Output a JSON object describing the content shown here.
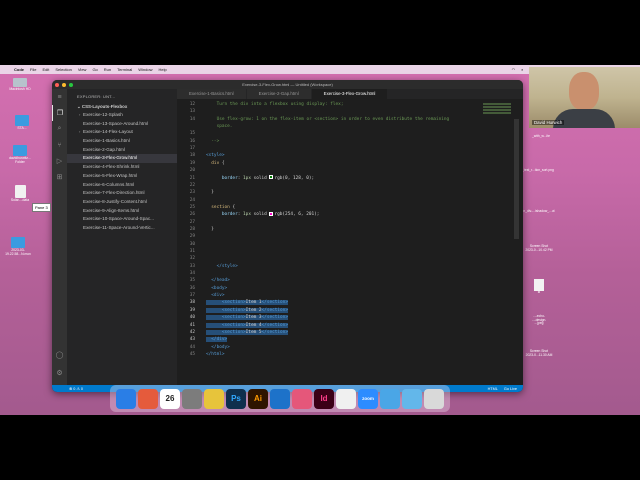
{
  "menubar": {
    "app": "Code",
    "items": [
      "File",
      "Edit",
      "Selection",
      "View",
      "Go",
      "Run",
      "Terminal",
      "Window",
      "Help"
    ],
    "clock": "Sun Mar 26"
  },
  "desktop_left_icons": [
    {
      "label": "Macintosh HD",
      "kind": "drive"
    },
    {
      "label": "STA...",
      "kind": "folder"
    },
    {
      "label": "davidhurwitz...\nFolder",
      "kind": "folder"
    },
    {
      "label": "Solar...-data",
      "kind": "doc"
    },
    {
      "label": "2023-03-\n19.22.58...N.mov",
      "kind": "folder"
    }
  ],
  "tooltip": "Pane 3",
  "vscode": {
    "title": "Exercise-3-Flex-Grow.html — Untitled (Workspace)",
    "explorer_header": "EXPLORER: UNT...",
    "root_folder": "CSS-Layouts-Flexbox",
    "files": [
      {
        "name": "Exercise-12-Splash",
        "folder": true,
        "selected": false
      },
      {
        "name": "Exercise-13-Space-Around.html",
        "folder": false,
        "selected": false
      },
      {
        "name": "Exercise-14-Flex-Layout",
        "folder": true,
        "selected": false
      },
      {
        "name": "Exercise-1-Basics.html",
        "folder": false,
        "selected": false
      },
      {
        "name": "Exercise-2-Gap.html",
        "folder": false,
        "selected": false
      },
      {
        "name": "Exercise-3-Flex-Grow.html",
        "folder": false,
        "selected": true
      },
      {
        "name": "Exercise-4-Flex-Shrink.html",
        "folder": false,
        "selected": false
      },
      {
        "name": "Exercise-5-Flex-Wrap.html",
        "folder": false,
        "selected": false
      },
      {
        "name": "Exercise-6-Columns.html",
        "folder": false,
        "selected": false
      },
      {
        "name": "Exercise-7-Flex-Direction.html",
        "folder": false,
        "selected": false
      },
      {
        "name": "Exercise-8-Justify-Content.html",
        "folder": false,
        "selected": false
      },
      {
        "name": "Exercise-9-Align-Items.html",
        "folder": false,
        "selected": false
      },
      {
        "name": "Exercise-10-Space-Around-Spac...",
        "folder": false,
        "selected": false
      },
      {
        "name": "Exercise-11-Space-Around-Vertic...",
        "folder": false,
        "selected": false
      }
    ],
    "tabs": [
      {
        "label": "Exercise-1-Basics.html",
        "active": false
      },
      {
        "label": "Exercise-2-Gap.html",
        "active": false
      },
      {
        "label": "Exercise-3-Flex-Grow.html",
        "active": true
      }
    ],
    "code_lines": [
      {
        "n": "12",
        "parts": [
          {
            "c": "t-cm",
            "t": "    Turn the div into a flexbox using display: flex;"
          }
        ]
      },
      {
        "n": "13",
        "parts": []
      },
      {
        "n": "14",
        "parts": [
          {
            "c": "t-cm",
            "t": "    Use flex-grow: 1 on the flex-item or <section> in order to even distribute the remaining"
          }
        ]
      },
      {
        "n": "",
        "parts": [
          {
            "c": "t-cm",
            "t": "    space."
          }
        ]
      },
      {
        "n": "15",
        "parts": []
      },
      {
        "n": "16",
        "parts": [
          {
            "c": "t-cm",
            "t": "  -->"
          }
        ]
      },
      {
        "n": "17",
        "parts": []
      },
      {
        "n": "18",
        "parts": [
          {
            "c": "t-tag",
            "t": "<style>"
          }
        ]
      },
      {
        "n": "19",
        "parts": [
          {
            "c": "t-sel",
            "t": "  div"
          },
          {
            "c": "t-txt",
            "t": " {"
          }
        ]
      },
      {
        "n": "20",
        "parts": []
      },
      {
        "n": "21",
        "parts": [
          {
            "c": "t-prop",
            "t": "      border"
          },
          {
            "c": "t-txt",
            "t": ": "
          },
          {
            "c": "t-num",
            "t": "1px"
          },
          {
            "c": "t-txt",
            "t": " solid "
          },
          {
            "c": "swatch",
            "color": "#008000"
          },
          {
            "c": "t-txt",
            "t": "rgb(0, 128, 0);"
          }
        ]
      },
      {
        "n": "22",
        "parts": []
      },
      {
        "n": "23",
        "parts": [
          {
            "c": "t-txt",
            "t": "  }"
          }
        ]
      },
      {
        "n": "24",
        "parts": []
      },
      {
        "n": "25",
        "parts": [
          {
            "c": "t-sel",
            "t": "  section"
          },
          {
            "c": "t-txt",
            "t": " {"
          }
        ]
      },
      {
        "n": "26",
        "parts": [
          {
            "c": "t-prop",
            "t": "      border"
          },
          {
            "c": "t-txt",
            "t": ": "
          },
          {
            "c": "t-num",
            "t": "1px"
          },
          {
            "c": "t-txt",
            "t": " solid "
          },
          {
            "c": "swatch",
            "color": "#fe06c9"
          },
          {
            "c": "t-txt",
            "t": "rgb(254, 6, 201);"
          }
        ]
      },
      {
        "n": "27",
        "parts": []
      },
      {
        "n": "28",
        "parts": [
          {
            "c": "t-txt",
            "t": "  }"
          }
        ]
      },
      {
        "n": "29",
        "parts": []
      },
      {
        "n": "30",
        "parts": []
      },
      {
        "n": "31",
        "parts": []
      },
      {
        "n": "32",
        "parts": []
      },
      {
        "n": "33",
        "parts": [
          {
            "c": "t-tag",
            "t": "    </style>"
          }
        ]
      },
      {
        "n": "34",
        "parts": []
      },
      {
        "n": "35",
        "parts": [
          {
            "c": "t-tag",
            "t": "  </head>"
          }
        ]
      },
      {
        "n": "36",
        "parts": [
          {
            "c": "t-tag",
            "t": "  <body>"
          }
        ]
      },
      {
        "n": "37",
        "parts": [
          {
            "c": "t-tag",
            "t": "  <div>"
          }
        ]
      },
      {
        "n": "38",
        "hl": true,
        "parts": [
          {
            "c": "t-tag",
            "t": "      <section>"
          },
          {
            "c": "t-txt",
            "t": "Item 1"
          },
          {
            "c": "t-tag",
            "t": "</section>"
          }
        ]
      },
      {
        "n": "39",
        "hl": true,
        "parts": [
          {
            "c": "t-tag",
            "t": "      <section>"
          },
          {
            "c": "t-txt",
            "t": "Item 2"
          },
          {
            "c": "t-tag",
            "t": "</section>"
          }
        ]
      },
      {
        "n": "40",
        "hl": true,
        "parts": [
          {
            "c": "t-tag",
            "t": "      <section>"
          },
          {
            "c": "t-txt",
            "t": "Item 3"
          },
          {
            "c": "t-tag",
            "t": "</section>"
          }
        ]
      },
      {
        "n": "41",
        "hl": true,
        "parts": [
          {
            "c": "t-tag",
            "t": "      <section>"
          },
          {
            "c": "t-txt",
            "t": "Item 4"
          },
          {
            "c": "t-tag",
            "t": "</section>"
          }
        ]
      },
      {
        "n": "42",
        "hl": true,
        "parts": [
          {
            "c": "t-tag",
            "t": "      <section>"
          },
          {
            "c": "t-txt",
            "t": "Item 5"
          },
          {
            "c": "t-tag",
            "t": "</section>"
          }
        ]
      },
      {
        "n": "43",
        "hl": true,
        "parts": [
          {
            "c": "t-tag",
            "t": "  </div>"
          }
        ]
      },
      {
        "n": "44",
        "parts": [
          {
            "c": "t-tag",
            "t": "  </body>"
          }
        ]
      },
      {
        "n": "45",
        "parts": [
          {
            "c": "t-tag",
            "t": "</html>"
          }
        ]
      }
    ],
    "status": {
      "left": "⊗ 0 ⚠ 0",
      "right": [
        "HTML",
        "Go Live"
      ]
    }
  },
  "dock": {
    "apps": [
      {
        "icon": "finder-icon",
        "color": "#2a7ee6"
      },
      {
        "icon": "launchpad-icon",
        "color": "#e55b3c"
      },
      {
        "icon": "calendar-icon",
        "color": "#ffffff"
      },
      {
        "icon": "settings-icon",
        "color": "#7c7c7c"
      },
      {
        "icon": "chrome-icon",
        "color": "#e7c43b"
      },
      {
        "icon": "photoshop-icon",
        "color": "#0f2f4d"
      },
      {
        "icon": "illustrator-icon",
        "color": "#2e1400"
      },
      {
        "icon": "vscode-icon",
        "color": "#1d72c9"
      },
      {
        "icon": "stack-icon",
        "color": "#e5577a"
      },
      {
        "icon": "indesign-icon",
        "color": "#3b0017"
      },
      {
        "icon": "lightbulb-icon",
        "color": "#f0f0f0"
      },
      {
        "icon": "zoom-icon",
        "color": "#2d8cff"
      },
      {
        "icon": "folder-icon",
        "color": "#4aa6e6"
      },
      {
        "icon": "downloads-icon",
        "color": "#63b7ea"
      },
      {
        "icon": "trash-icon",
        "color": "#d9d9d9"
      }
    ],
    "calendar_day": "26",
    "calendar_month": "MAR",
    "ps": "Ps",
    "ai": "Ai",
    "id": "Id",
    "zoom": "zoom"
  },
  "desktop_right_icons": [
    {
      "label": "STA...a"
    },
    {
      "label": "_with_w...ite"
    },
    {
      "label": "_test_r...tion_sort.png"
    },
    {
      "label": "n_div-...ishadow_...ut"
    },
    {
      "label": "Screen Shot\n2023-0...10.42 PM"
    },
    {
      "label": "id"
    },
    {
      "label": "...-echo-\n...-design.\n...jpeg"
    },
    {
      "label": "Screen Shot\n2023-0...11.30 AM"
    }
  ],
  "webcam": {
    "name": "David Hurwich"
  }
}
